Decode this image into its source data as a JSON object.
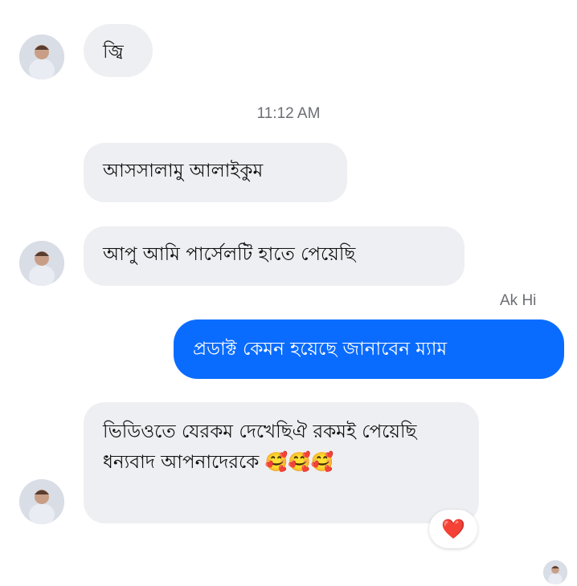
{
  "messages": [
    {
      "text": "জ্বি"
    },
    {
      "text": "আসসালামু আলাইকুম"
    },
    {
      "text": "আপু আমি পার্সেলটি হাতে পেয়েছি"
    },
    {
      "text": "প্রডাক্ট কেমন হয়েছে জানাবেন ম্যাম"
    },
    {
      "text": "ভিডিওতে যেরকম দেখেছিঐ রকমই পেয়েছি ধন্যবাদ আপনাদেরকে 🥰🥰🥰"
    }
  ],
  "timestamp": "11:12 AM",
  "sender_name": "Ak Hi",
  "reaction": "❤️",
  "avatar_icon": "contact-avatar-photo",
  "colors": {
    "incoming_bubble": "#eeeff2",
    "outgoing_bubble": "#0a6cff",
    "timestamp_text": "#6c6e73",
    "reaction_heart": "#e41e3f"
  }
}
